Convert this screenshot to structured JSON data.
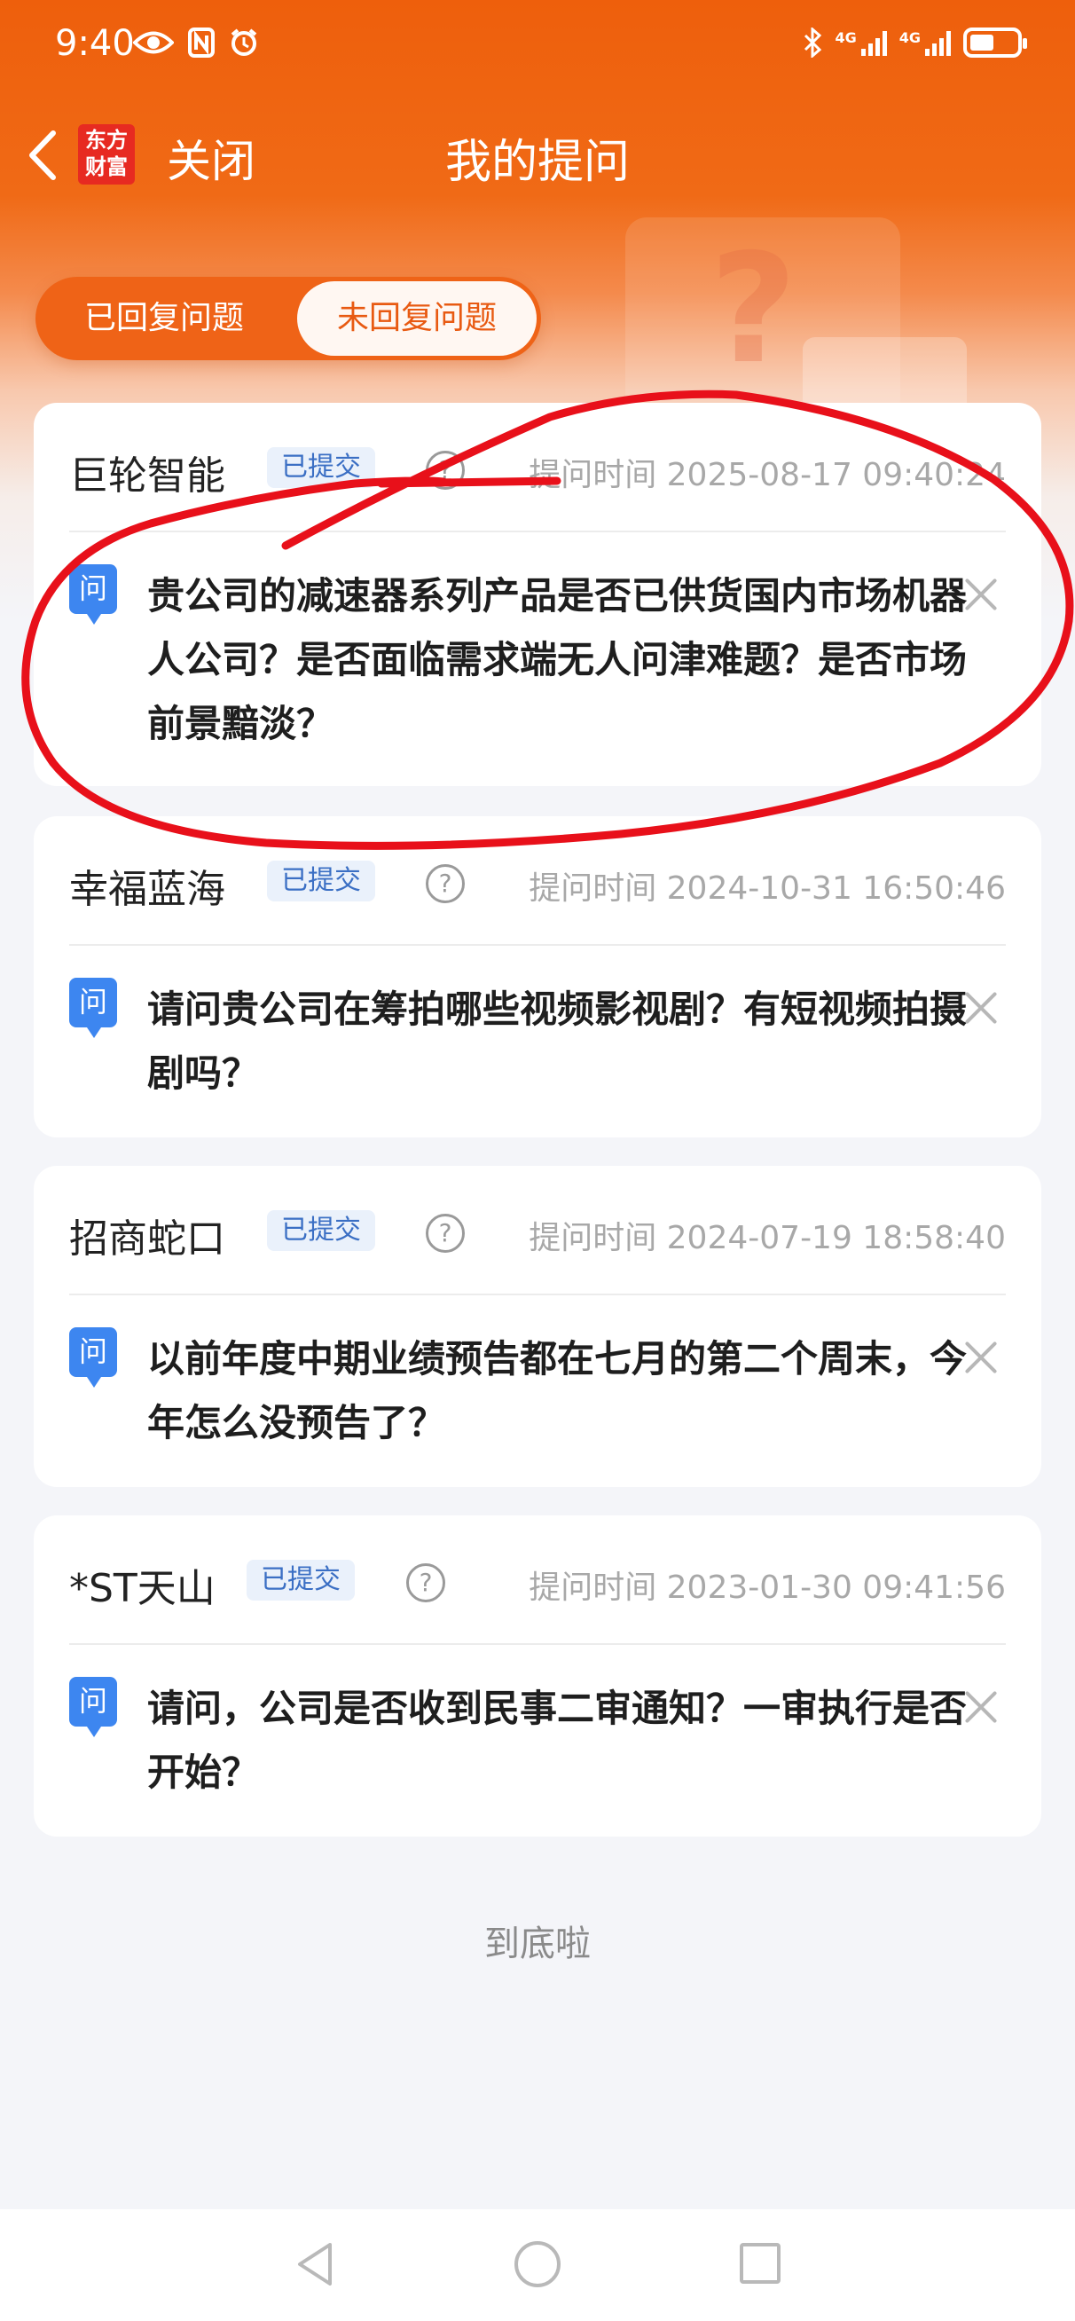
{
  "status_bar": {
    "time": "9:40",
    "left_icons": [
      "eye-icon",
      "nfc-icon",
      "alarm-icon"
    ],
    "right_icons": [
      "bluetooth-icon",
      "signal-4g-icon",
      "signal-4g-icon",
      "battery-icon"
    ],
    "network_label": "4G"
  },
  "header": {
    "logo_text_line1": "东方",
    "logo_text_line2": "财富",
    "close_label": "关闭",
    "title": "我的提问"
  },
  "tabs": [
    {
      "label": "已回复问题",
      "active": false
    },
    {
      "label": "未回复问题",
      "active": true
    }
  ],
  "questions": [
    {
      "company": "巨轮智能",
      "status": "已提交",
      "time": "提问时间 2025-08-17 09:40:24",
      "icon_label": "问",
      "text": "贵公司的减速器系列产品是否已供货国内市场机器人公司？是否面临需求端无人问津难题？是否市场前景黯淡？"
    },
    {
      "company": "幸福蓝海",
      "status": "已提交",
      "time": "提问时间 2024-10-31 16:50:46",
      "icon_label": "问",
      "text": "请问贵公司在筹拍哪些视频影视剧？有短视频拍摄剧吗？"
    },
    {
      "company": "招商蛇口",
      "status": "已提交",
      "time": "提问时间 2024-07-19 18:58:40",
      "icon_label": "问",
      "text": "以前年度中期业绩预告都在七月的第二个周末，今年怎么没预告了？"
    },
    {
      "company": "*ST天山",
      "status": "已提交",
      "time": "提问时间 2023-01-30 09:41:56",
      "icon_label": "问",
      "text": "请问，公司是否收到民事二审通知？一审执行是否开始？"
    }
  ],
  "help_symbol": "?",
  "end_text": "到底啦",
  "colors": {
    "brand_orange": "#ee5f0c",
    "annotation_red": "#e8101a",
    "badge_blue": "#3b6fc4",
    "question_icon_blue": "#3d86f0"
  }
}
